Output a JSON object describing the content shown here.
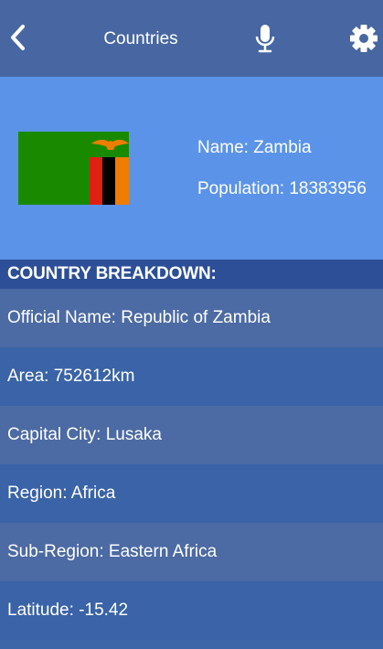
{
  "header": {
    "title": "Countries",
    "icons": {
      "back": "chevron-left-icon",
      "mic": "microphone-icon",
      "settings": "gear-icon"
    }
  },
  "country": {
    "name_line": "Name: Zambia",
    "population_line": "Population: 18383956",
    "flag_colors": {
      "field": "#198a00",
      "red": "#de2010",
      "black": "#000000",
      "orange": "#ef7d00"
    }
  },
  "breakdown": {
    "heading": "COUNTRY BREAKDOWN:",
    "rows": [
      "Official Name: Republic of Zambia",
      "Area: 752612km",
      "Capital City: Lusaka",
      "Region: Africa",
      "Sub-Region: Eastern Africa",
      "Latitude: -15.42"
    ]
  },
  "colors": {
    "topbar": "#4867a2",
    "hero": "#5b93e8",
    "section_header": "#2c4f97",
    "row_light": "#4c6aa3",
    "row_dark": "#3a63a8"
  }
}
